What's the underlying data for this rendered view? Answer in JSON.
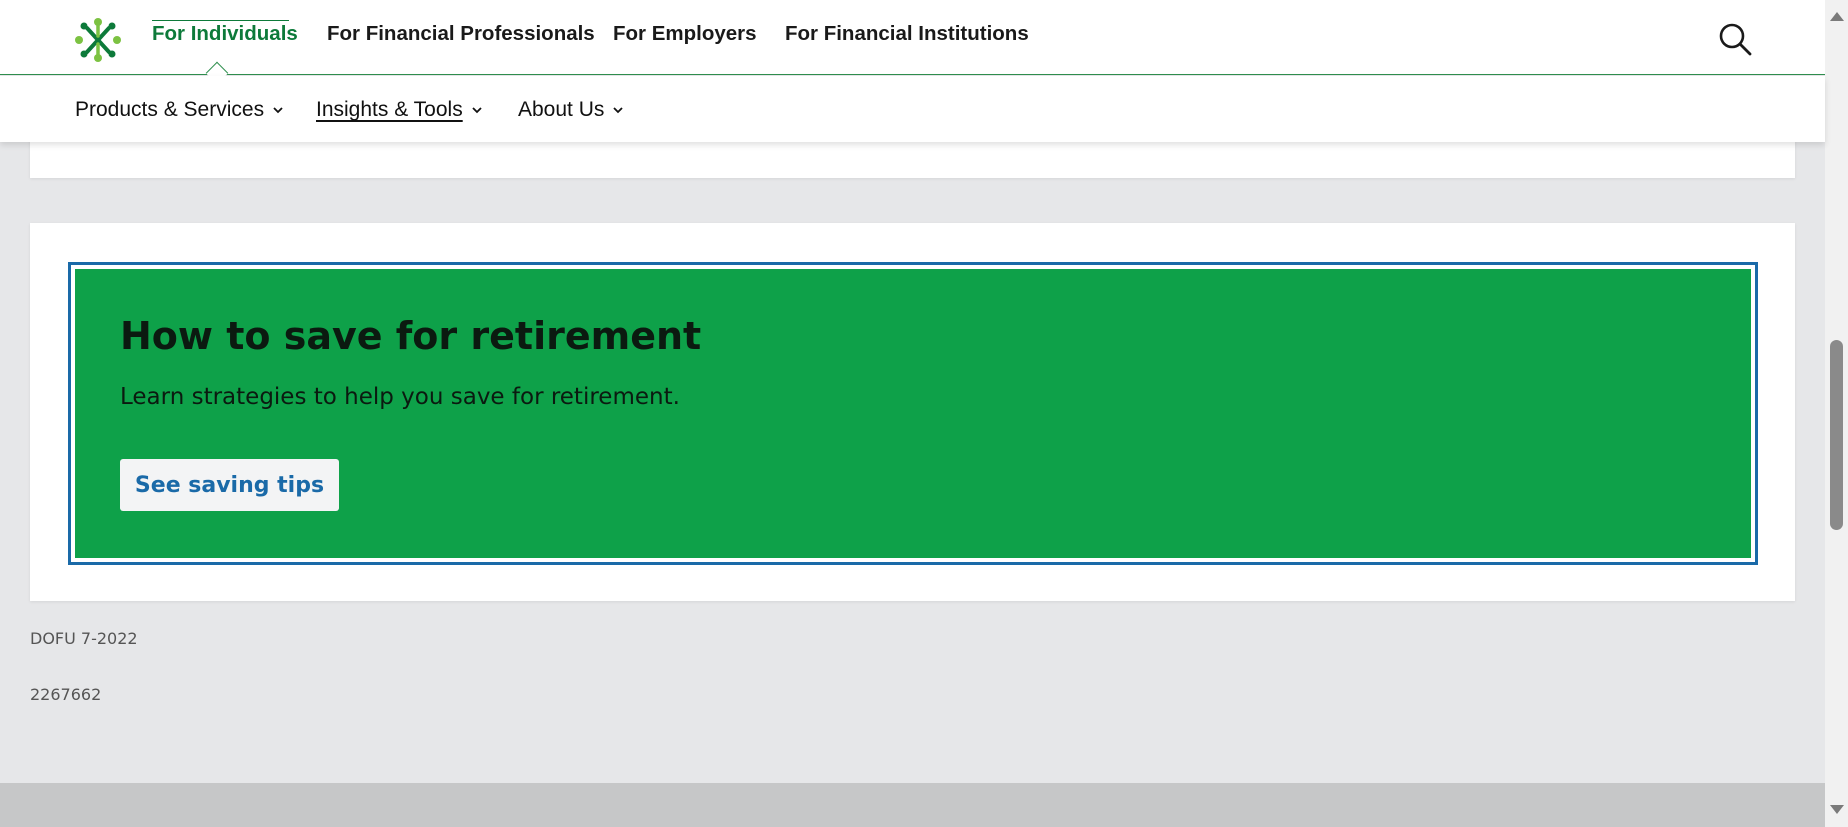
{
  "header": {
    "nav_items": [
      {
        "label": "For Individuals",
        "active": true
      },
      {
        "label": "For Financial Professionals"
      },
      {
        "label": "For Employers"
      },
      {
        "label": "For Financial Institutions"
      }
    ],
    "logo_icon": "brand-logo-icon",
    "search_icon": "search-icon"
  },
  "subnav": {
    "items": [
      {
        "label": "Products & Services",
        "icon": "chevron-down-icon"
      },
      {
        "label": "Insights & Tools",
        "icon": "chevron-down-icon",
        "underlined": true
      },
      {
        "label": "About Us",
        "icon": "chevron-down-icon"
      }
    ]
  },
  "promo": {
    "title": "How to save for retirement",
    "description": "Learn strategies to help you save for retirement.",
    "button_label": "See saving tips"
  },
  "footnotes": [
    "DOFU 7-2022",
    "2267662"
  ],
  "colors": {
    "brand_green": "#0d7a3a",
    "promo_green": "#0ea149",
    "link_blue": "#1a6aa8",
    "page_bg": "#e6e7e9"
  }
}
